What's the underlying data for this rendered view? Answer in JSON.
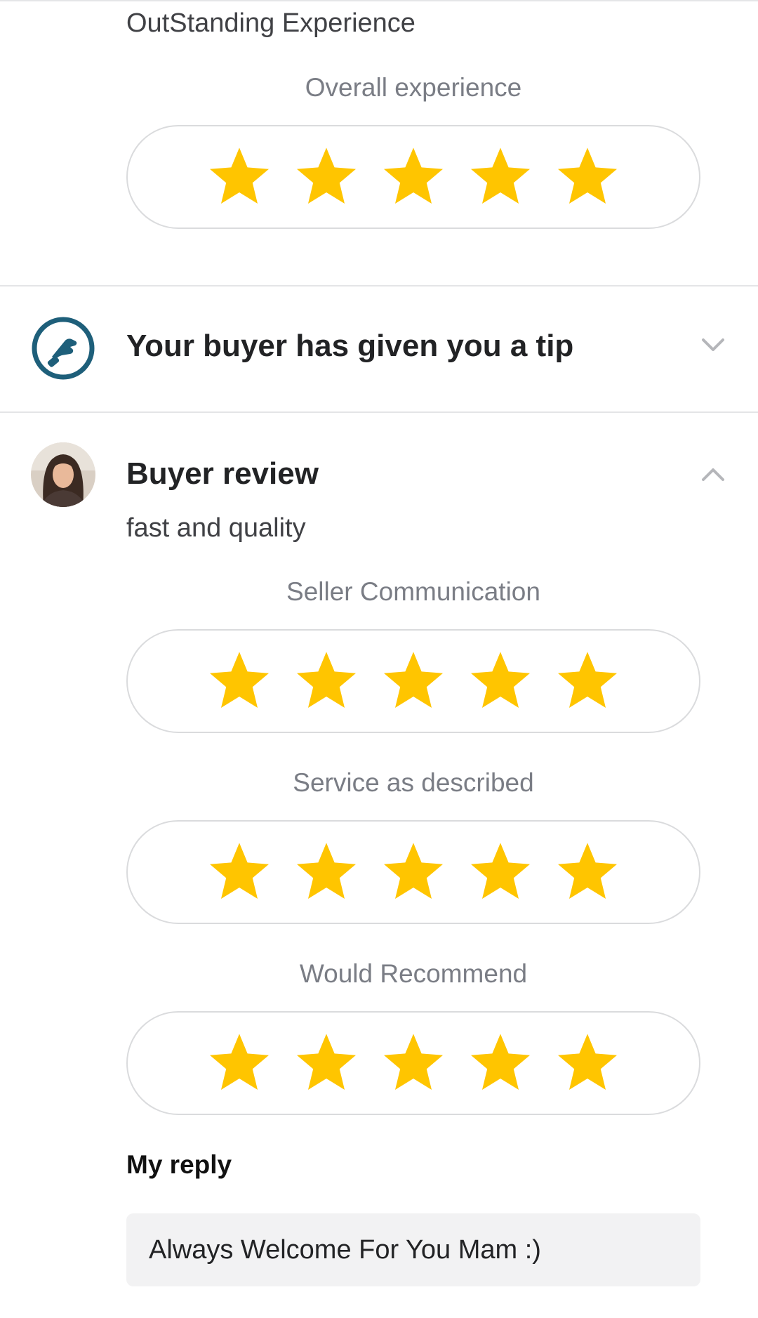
{
  "previous_review": {
    "text": "OutStanding Experience",
    "ratings": [
      {
        "label": "Overall experience",
        "stars": 5,
        "max": 5
      }
    ]
  },
  "tip": {
    "title": "Your buyer has given you a tip",
    "icon": "tip-hand-icon",
    "expanded": false
  },
  "buyer_review": {
    "title": "Buyer review",
    "comment": "fast and quality",
    "expanded": true,
    "ratings": [
      {
        "label": "Seller Communication",
        "stars": 5,
        "max": 5
      },
      {
        "label": "Service as described",
        "stars": 5,
        "max": 5
      },
      {
        "label": "Would Recommend",
        "stars": 5,
        "max": 5
      }
    ]
  },
  "reply": {
    "title": "My reply",
    "text": "Always Welcome For You Mam :)"
  },
  "colors": {
    "star": "#FFC500",
    "tip_icon": "#1E5F7A",
    "divider": "#E4E5E7",
    "label": "#7A7D85",
    "reply_bg": "#F2F2F3"
  }
}
